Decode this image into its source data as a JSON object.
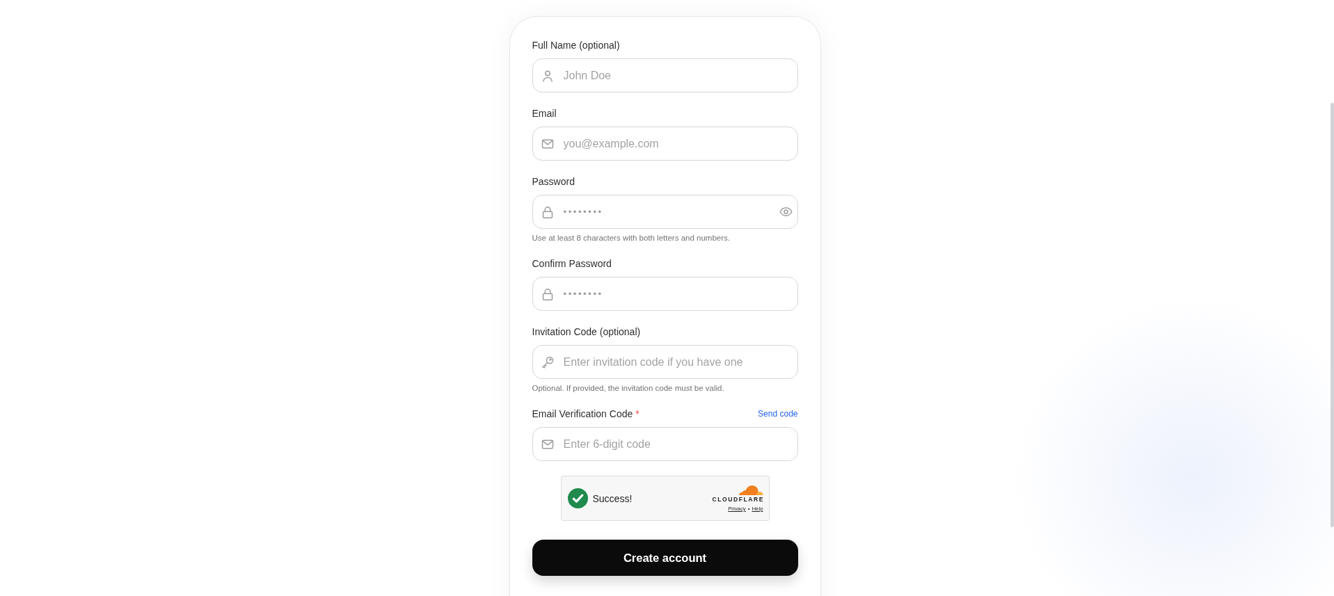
{
  "form": {
    "fields": [
      {
        "kind": "name",
        "label": "Full Name (optional)",
        "placeholder": "John Doe",
        "reveal_toggle": false
      },
      {
        "kind": "email",
        "label": "Email",
        "placeholder": "you@example.com",
        "reveal_toggle": false
      },
      {
        "kind": "password",
        "label": "Password",
        "value": "••••••••",
        "reveal_toggle": true,
        "hint": "Use at least 8 characters with both letters and numbers."
      },
      {
        "kind": "password",
        "label": "Confirm Password",
        "value": "••••••••",
        "reveal_toggle": false
      },
      {
        "kind": "invite",
        "label": "Invitation Code (optional)",
        "placeholder": "Enter invitation code if you have one",
        "reveal_toggle": false,
        "hint": "Optional. If provided, the invitation code must be valid."
      },
      {
        "kind": "verification",
        "label": "Email Verification Code",
        "required_mark": "*",
        "action": "Send code",
        "placeholder": "Enter 6-digit code",
        "reveal_toggle": false
      }
    ],
    "captcha": {
      "verified": true,
      "status": "Success!",
      "brand": "CLOUDFLARE",
      "links": [
        "Privacy",
        "Help"
      ],
      "separator": "•"
    },
    "submit": {
      "label": "Create account"
    }
  }
}
